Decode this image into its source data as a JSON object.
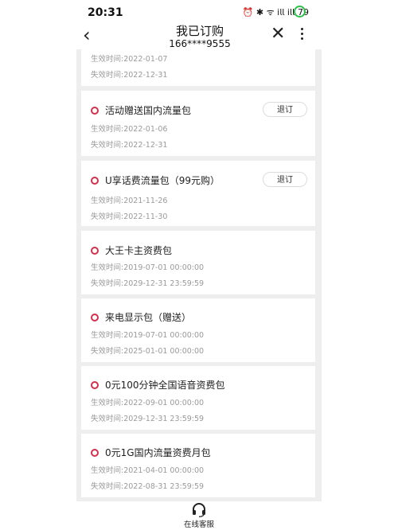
{
  "status": {
    "time": "20:31",
    "icons_text": "⏰ ✱ ᯤ 𝗂𝗅𝗅 𝗂𝗅𝗅",
    "battery": "79"
  },
  "header": {
    "title": "我已订购",
    "subtitle": "166****9555"
  },
  "labels": {
    "effective": "生效时间:",
    "expire": "失效时间:",
    "unsubscribe": "退订"
  },
  "items": [
    {
      "name": "",
      "start": "2022-01-07",
      "end": "2022-12-31",
      "unsub": false
    },
    {
      "name": "活动赠送国内流量包",
      "start": "2022-01-06",
      "end": "2022-12-31",
      "unsub": true
    },
    {
      "name": "U享话费流量包（99元购）",
      "start": "2021-11-26",
      "end": "2022-11-30",
      "unsub": true
    },
    {
      "name": "大王卡主资费包",
      "start": "2019-07-01 00:00:00",
      "end": "2029-12-31 23:59:59",
      "unsub": false
    },
    {
      "name": "来电显示包（赠送）",
      "start": "2019-07-01 00:00:00",
      "end": "2025-01-01 00:00:00",
      "unsub": false
    },
    {
      "name": "0元100分钟全国语音资费包",
      "start": "2022-09-01 00:00:00",
      "end": "2029-12-31 23:59:59",
      "unsub": false
    },
    {
      "name": "0元1G国内流量资费月包",
      "start": "2021-04-01 00:00:00",
      "end": "2022-08-31 23:59:59",
      "unsub": false
    }
  ],
  "footer": {
    "service_label": "在线客服"
  }
}
